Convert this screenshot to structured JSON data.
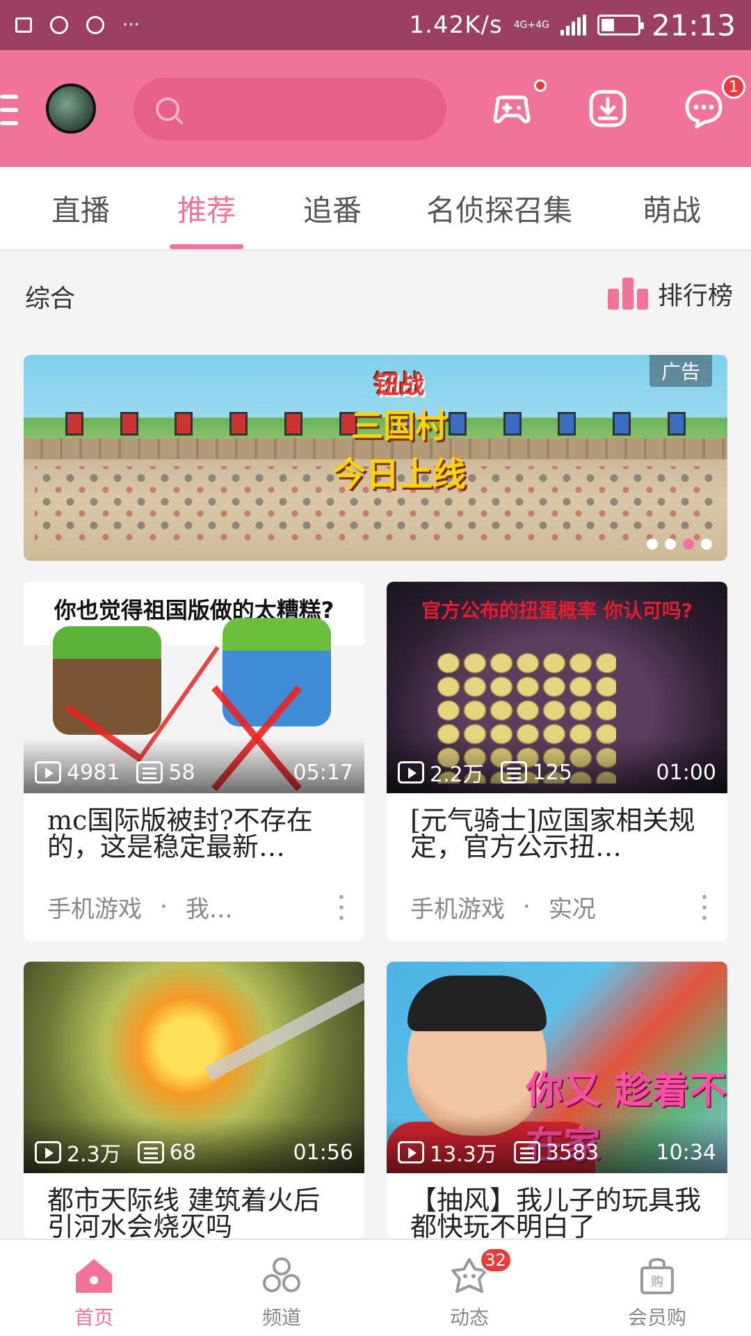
{
  "status_bar": {
    "speed": "1.42K/s",
    "network": "4G+4G",
    "time": "21:13",
    "battery_level": 0.35,
    "more": "···"
  },
  "header": {
    "search_placeholder": "",
    "gamepad_dot": true,
    "messages_badge": "1"
  },
  "tabs": [
    {
      "label": "直播",
      "active": false
    },
    {
      "label": "推荐",
      "active": true
    },
    {
      "label": "追番",
      "active": false
    },
    {
      "label": "名侦探召集",
      "active": false
    },
    {
      "label": "萌战",
      "active": false
    }
  ],
  "section": {
    "title": "综合",
    "ranking_label": "排行榜"
  },
  "banner": {
    "ad_tag": "广告",
    "art_line1": "钮战",
    "art_line2": "三国村",
    "art_line3": "今日上线",
    "active_indicator": 2,
    "indicator_count": 4
  },
  "cards": [
    {
      "title": "mc国际版被封?不存在的，这是稳定最新…",
      "thumb_caption": "你也觉得祖国版做的太糟糕?",
      "views": "4981",
      "danmaku": "58",
      "duration": "05:17",
      "category": "手机游戏",
      "tag": "我…"
    },
    {
      "title": "[元气骑士]应国家相关规定，官方公示扭…",
      "thumb_caption": "官方公布的扭蛋概率 你认可吗?",
      "views": "2.2万",
      "danmaku": "125",
      "duration": "01:00",
      "category": "手机游戏",
      "tag": "实况"
    },
    {
      "title": "都市天际线 建筑着火后引河水会烧灭吗",
      "views": "2.3万",
      "danmaku": "68",
      "duration": "01:56"
    },
    {
      "title": "【抽风】我儿子的玩具我都快玩不明白了",
      "thumb_caption": "你又 趁着不在家",
      "views": "13.3万",
      "danmaku": "3583",
      "duration": "10:34"
    }
  ],
  "bottom_nav": [
    {
      "label": "首页",
      "icon": "home-icon",
      "active": true
    },
    {
      "label": "频道",
      "icon": "channel-icon",
      "active": false
    },
    {
      "label": "动态",
      "icon": "dynamic-icon",
      "active": false,
      "badge": "32"
    },
    {
      "label": "会员购",
      "icon": "shop-bag-icon",
      "active": false
    }
  ],
  "colors": {
    "status_bar": "#9b4063",
    "brand_pink": "#f17399",
    "badge_red": "#e83b3b"
  }
}
